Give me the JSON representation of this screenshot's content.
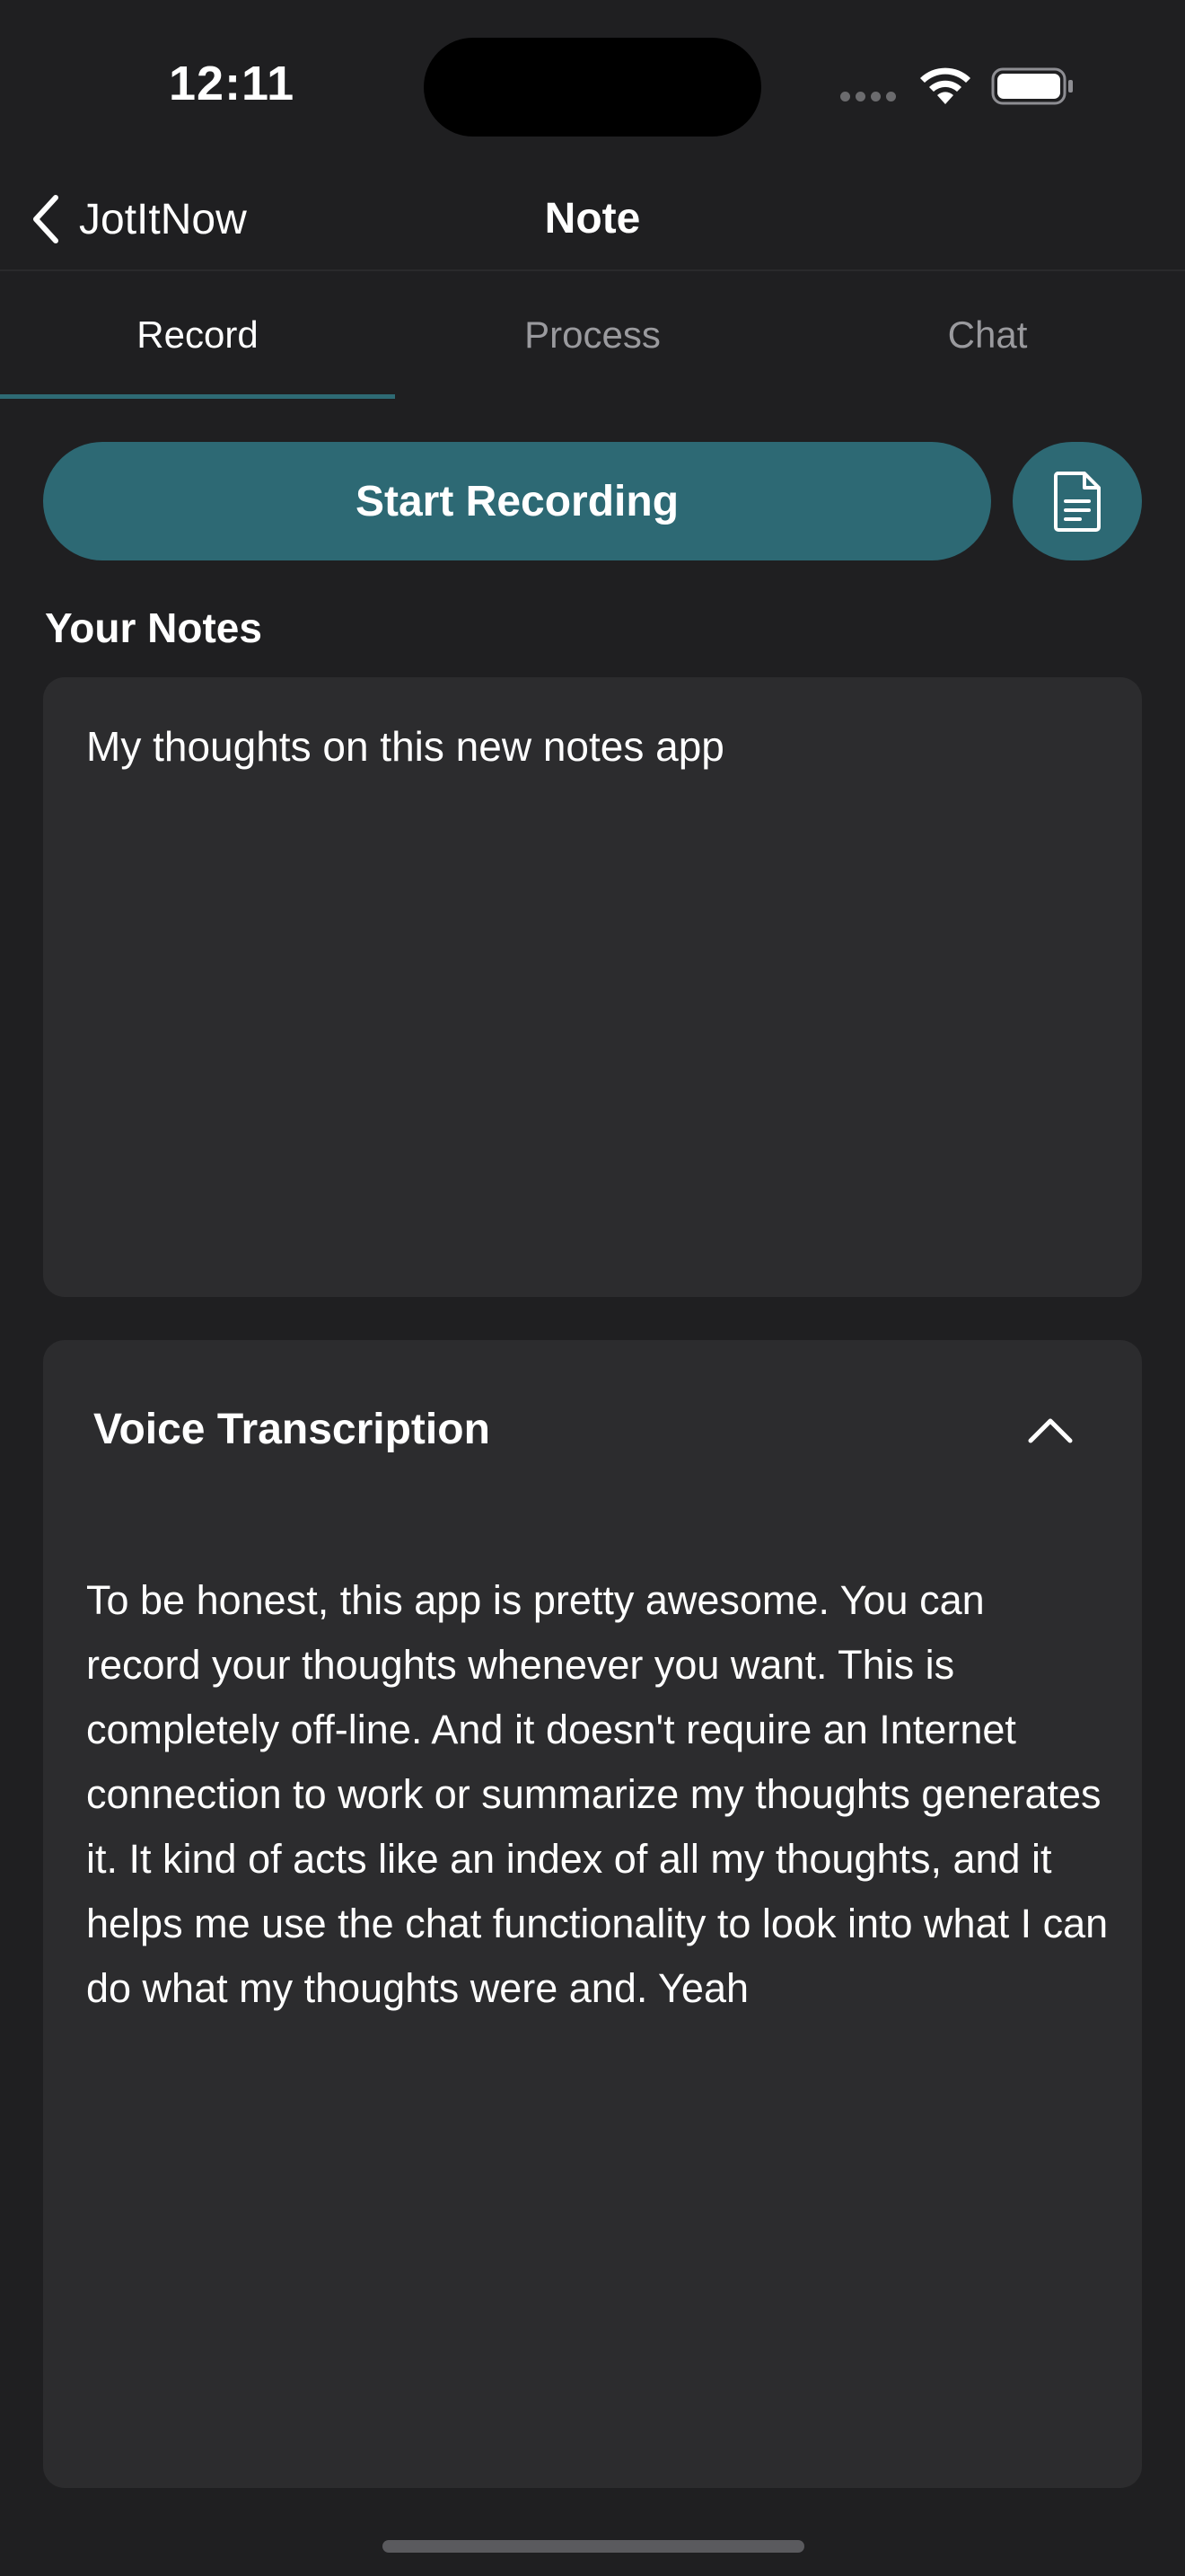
{
  "status_bar": {
    "time": "12:11",
    "icons": [
      "cellular-signal-icon",
      "wifi-icon",
      "battery-icon"
    ]
  },
  "nav": {
    "back_label": "JotItNow",
    "title": "Note"
  },
  "tabs": [
    {
      "label": "Record",
      "active": true
    },
    {
      "label": "Process",
      "active": false
    },
    {
      "label": "Chat",
      "active": false
    }
  ],
  "record": {
    "button_label": "Start Recording",
    "doc_icon": "document-icon"
  },
  "notes": {
    "label": "Your Notes",
    "value": "My thoughts on this new notes app"
  },
  "transcription": {
    "title": "Voice Transcription",
    "expanded": true,
    "text": "To be honest, this app is pretty awesome. You can record your thoughts whenever you want. This is completely off-line. And it doesn't require an Internet connection to work or summarize my thoughts generates it. It kind of acts like an index of all my thoughts, and it helps me use the chat functionality to look into what I can do what my thoughts were and. Yeah"
  },
  "colors": {
    "accent": "#2d6974",
    "background": "#1f1f21",
    "card": "#2c2c2e"
  }
}
